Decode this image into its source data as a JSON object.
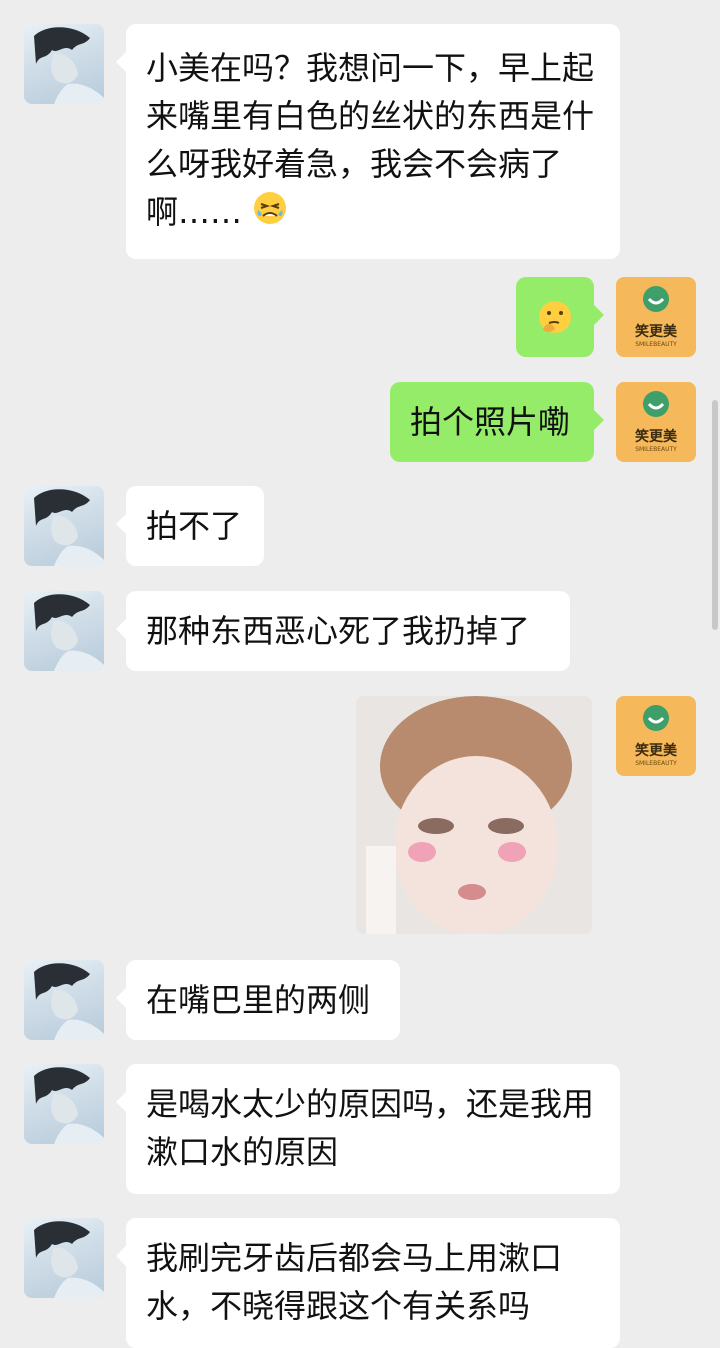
{
  "chat": {
    "messages": [
      {
        "from": "user",
        "text": "小美在吗？我想问一下，早上起来嘴里有白色的丝状的东西是什么呀我好着急，我会不会病了啊……"
      },
      {
        "from": "brand",
        "emoji": "thinking-face"
      },
      {
        "from": "brand",
        "text": "拍个照片嘞"
      },
      {
        "from": "user",
        "text": "拍不了"
      },
      {
        "from": "user",
        "text": "那种东西恶心死了我扔掉了"
      },
      {
        "from": "brand",
        "image": "child-sticker"
      },
      {
        "from": "user",
        "text": "在嘴巴里的两侧"
      },
      {
        "from": "user",
        "text": "是喝水太少的原因吗，还是我用漱口水的原因"
      },
      {
        "from": "user",
        "text": "我刷完牙齿后都会马上用漱口水，不晓得跟这个有关系吗"
      }
    ],
    "brand_avatar": {
      "label": "笑更美",
      "sub": "SMILEBEAUTY"
    }
  },
  "colors": {
    "background": "#ededed",
    "incoming": "#ffffff",
    "outgoing": "#95ec69",
    "brand": "#f5b85a"
  }
}
